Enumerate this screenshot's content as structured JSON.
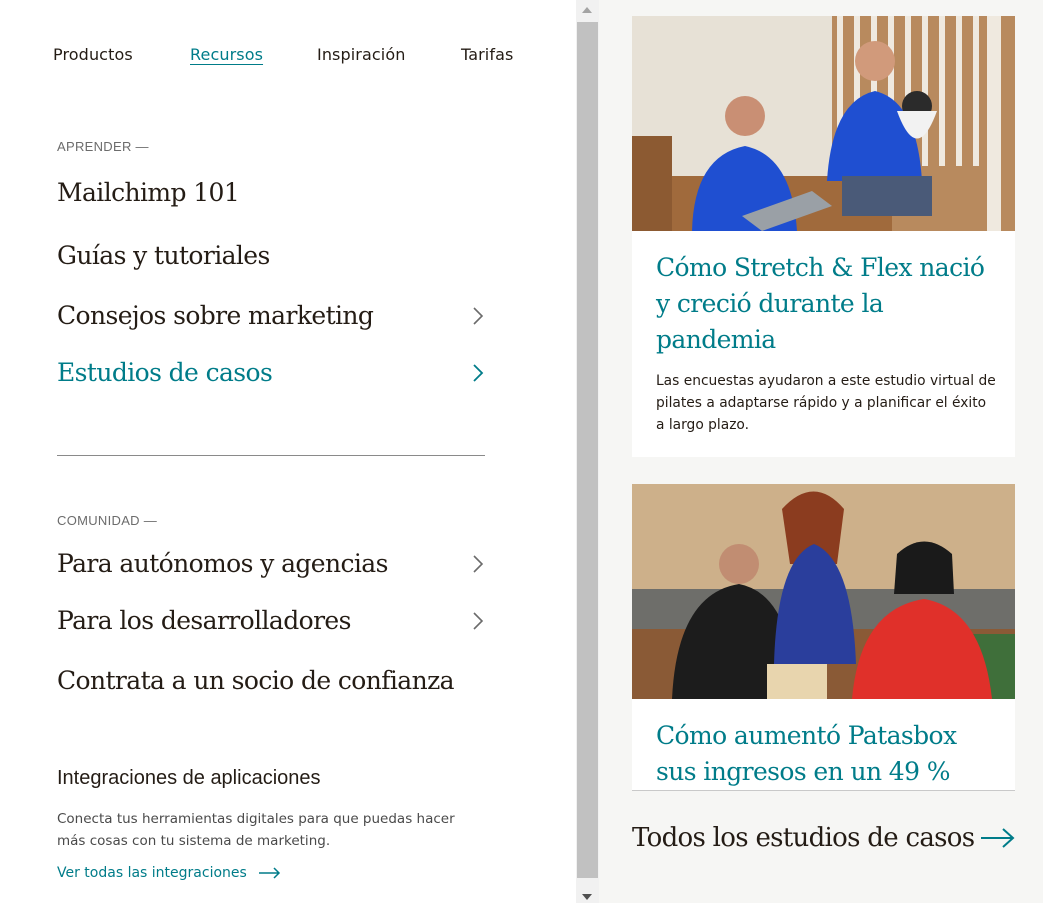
{
  "nav": {
    "items": [
      {
        "label": "Productos",
        "active": false
      },
      {
        "label": "Recursos",
        "active": true
      },
      {
        "label": "Inspiración",
        "active": false
      },
      {
        "label": "Tarifas",
        "active": false
      }
    ]
  },
  "learn": {
    "label": "APRENDER —",
    "items": [
      {
        "label": "Mailchimp 101",
        "chevron": false
      },
      {
        "label": "Guías y tutoriales",
        "chevron": false
      },
      {
        "label": "Consejos sobre marketing",
        "chevron": true
      },
      {
        "label": "Estudios de casos",
        "chevron": true,
        "highlighted": true
      }
    ]
  },
  "community": {
    "label": "COMUNIDAD —",
    "items": [
      {
        "label": "Para autónomos y agencias",
        "chevron": true
      },
      {
        "label": "Para los desarrolladores",
        "chevron": true
      },
      {
        "label": "Contrata a un socio de confianza",
        "chevron": false
      }
    ]
  },
  "integrations": {
    "title": "Integraciones de aplicaciones",
    "description": "Conecta tus herramientas digitales para que puedas hacer más cosas con tu sistema de marketing.",
    "link": "Ver todas las integraciones"
  },
  "cards": [
    {
      "title": "Cómo Stretch & Flex nació y creció durante la pandemia",
      "description": "Las encuestas ayudaron a este estudio virtual de pilates a adaptarse rápido y a planificar el éxito a largo plazo."
    },
    {
      "title": "Cómo aumentó Patasbox sus ingresos en un 49 %"
    }
  ],
  "all_cases_link": "Todos los estudios de casos",
  "colors": {
    "accent": "#007c89",
    "text": "#241c15",
    "panel_bg": "#f6f6f4"
  }
}
